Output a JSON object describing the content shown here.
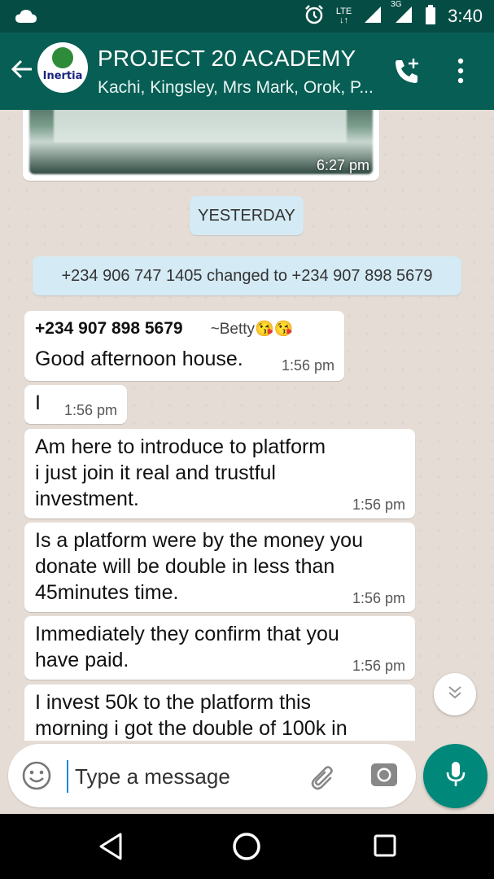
{
  "status_bar": {
    "network_label": "LTE",
    "network_sub": "↓↑",
    "sim2_label": "3G",
    "time": "3:40"
  },
  "header": {
    "group_name": "PROJECT 20 ACADEMY",
    "members": "Kachi, Kingsley, Mrs Mark, Orok, P...",
    "avatar_text": "Inertia"
  },
  "chat": {
    "image_message_time": "6:27 pm",
    "date_divider": "YESTERDAY",
    "system_message": "+234 906 747 1405 changed to +234 907 898 5679",
    "messages": [
      {
        "sender": "+234 907 898 5679",
        "nickname": "~Betty😘😘",
        "text": "Good afternoon house.",
        "time": "1:56 pm"
      },
      {
        "text": "I",
        "time": "1:56 pm"
      },
      {
        "text": "Am here to introduce to platform\ni just join it real and trustful\ninvestment.",
        "time": "1:56 pm"
      },
      {
        "text": "Is a platform were by the money you\ndonate will be double in less than\n45minutes time.",
        "time": "1:56 pm"
      },
      {
        "text": "Immediately they confirm that you\nhave paid.",
        "time": "1:56 pm"
      },
      {
        "text": "I invest 50k to the platform this\nmorning i got the double of 100k in",
        "time": ""
      }
    ]
  },
  "composer": {
    "placeholder": "Type a message"
  },
  "colors": {
    "header": "#075e54",
    "status_bar": "#054d44",
    "chat_bg": "#e5ddd5",
    "system_chip": "#d4eaf4",
    "mic": "#00897b"
  }
}
